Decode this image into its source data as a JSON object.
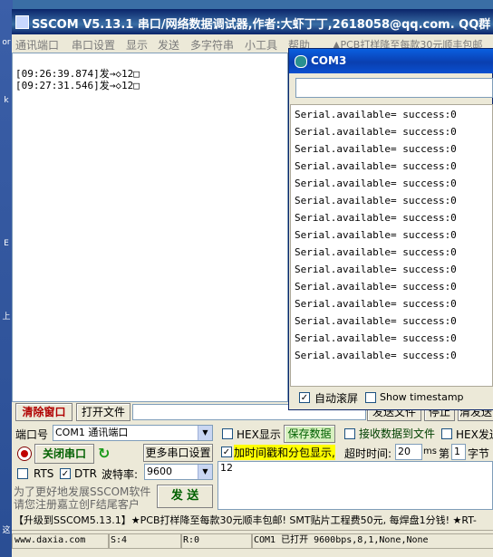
{
  "desktop": {
    "marks": [
      "or",
      "k",
      "E",
      "上",
      "这"
    ]
  },
  "sscom": {
    "title": "SSCOM V5.13.1 串口/网络数据调试器,作者:大虾丁丁,2618058@qq.com. QQ群",
    "menu": [
      "通讯端口",
      "串口设置",
      "显示",
      "发送",
      "多字符串",
      "小工具",
      "帮助",
      "▲PCB打样降至每款30元顺丰包邮"
    ],
    "receive_lines": [
      "[09:26:39.874]发→◇12□",
      "[09:27:31.546]发→◇12□"
    ],
    "clear_window": "清除窗口",
    "open_file": "打开文件",
    "send_file": "发送文件",
    "stop": "停止",
    "clear_send": "清发送",
    "port_label": "端口号",
    "port_value": "COM1 通讯端口",
    "hex_display": "HEX显示",
    "save_data": "保存数据",
    "recv_to_file": "接收数据到文件",
    "hex_send": "HEX发送",
    "close_port": "关闭串口",
    "more_settings": "更多串口设置",
    "timestamp_option": "加时间戳和分包显示,",
    "timeout_label": "超时时间:",
    "timeout_value": "20",
    "timeout_unit": "ms",
    "nth_label": "第",
    "nth_value": "1",
    "byte_label": "字节",
    "rts": "RTS",
    "dtr": "DTR",
    "baud_label": "波特率:",
    "baud_value": "9600",
    "send_text": "12",
    "promo_line1": "为了更好地发展SSCOM软件",
    "promo_line2": "请您注册嘉立创F结尾客户",
    "send_button": "发 送",
    "ticker": "【升级到SSCOM5.13.1】★PCB打样降至每款30元顺丰包邮! SMT贴片工程费50元, 每焊盘1分钱! ★RT-",
    "status": {
      "website": "www.daxia.com",
      "sent": "S:4",
      "received": "R:0",
      "port_state": "COM1 已打开  9600bps,8,1,None,None"
    }
  },
  "com3": {
    "title": "COM3",
    "input_value": "",
    "output_lines": [
      "Serial.available= success:0",
      "Serial.available= success:0",
      "Serial.available= success:0",
      "Serial.available= success:0",
      "Serial.available= success:0",
      "Serial.available= success:0",
      "Serial.available= success:0",
      "Serial.available= success:0",
      "Serial.available= success:0",
      "Serial.available= success:0",
      "Serial.available= success:0",
      "Serial.available= success:0",
      "Serial.available= success:0",
      "Serial.available= success:0",
      "Serial.available= success:0"
    ],
    "autoscroll": "自动滚屏",
    "autoscroll_checked": true,
    "show_timestamp": "Show timestamp",
    "show_timestamp_checked": false
  },
  "colors": {
    "title_blue": "#0a246a",
    "com3_title": "#0a4fd0",
    "timestamp_highlight": "#ffff00",
    "save_green": "#d8f0c0"
  }
}
